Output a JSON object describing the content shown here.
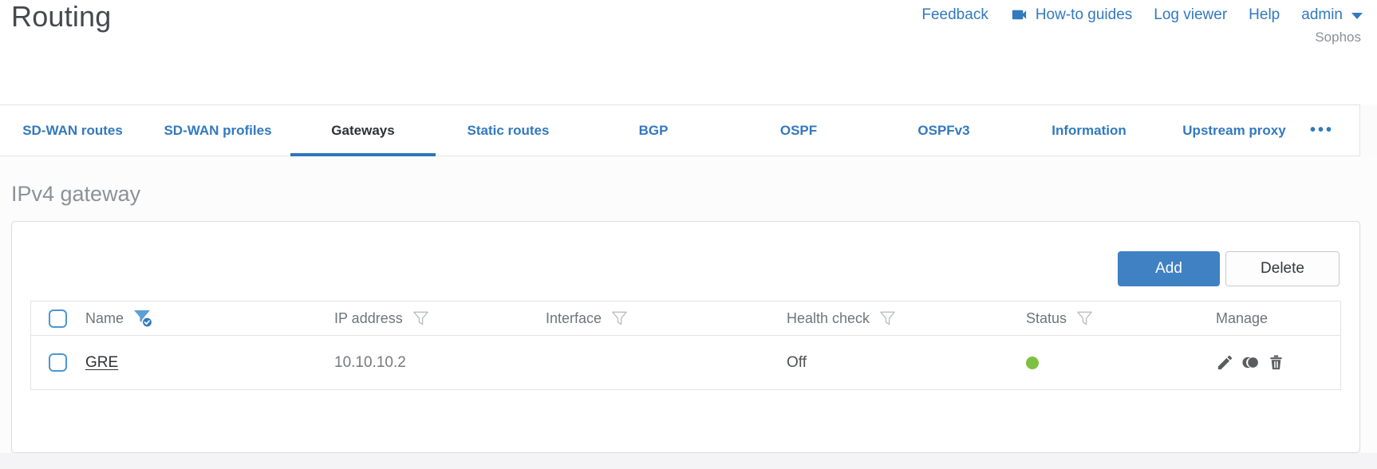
{
  "header": {
    "title": "Routing",
    "links": {
      "feedback": "Feedback",
      "howto": "How-to guides",
      "logviewer": "Log viewer",
      "help": "Help",
      "user": "admin"
    },
    "brand": "Sophos"
  },
  "tabs": {
    "items": [
      {
        "label": "SD-WAN routes",
        "active": false
      },
      {
        "label": "SD-WAN profiles",
        "active": false
      },
      {
        "label": "Gateways",
        "active": true
      },
      {
        "label": "Static routes",
        "active": false
      },
      {
        "label": "BGP",
        "active": false
      },
      {
        "label": "OSPF",
        "active": false
      },
      {
        "label": "OSPFv3",
        "active": false
      },
      {
        "label": "Information",
        "active": false
      },
      {
        "label": "Upstream proxy",
        "active": false
      }
    ],
    "more_label": "•••"
  },
  "section": {
    "title": "IPv4 gateway"
  },
  "toolbar": {
    "add_label": "Add",
    "delete_label": "Delete"
  },
  "table": {
    "columns": [
      {
        "label": "Name",
        "filter": "active"
      },
      {
        "label": "IP address",
        "filter": "inactive"
      },
      {
        "label": "Interface",
        "filter": "inactive"
      },
      {
        "label": "Health check",
        "filter": "inactive"
      },
      {
        "label": "Status",
        "filter": "inactive"
      },
      {
        "label": "Manage",
        "filter": "none"
      }
    ],
    "rows": [
      {
        "name": "GRE",
        "ip_address": "10.10.10.2",
        "interface": "",
        "health_check": "Off",
        "status": "green-up",
        "manage": [
          "edit-icon",
          "clone-icon",
          "trash-icon"
        ]
      }
    ]
  },
  "colors": {
    "link_blue": "#3279be",
    "active_tab_underline": "#2e77b8",
    "add_button": "#3f81c3",
    "status_green": "#7dc142"
  }
}
